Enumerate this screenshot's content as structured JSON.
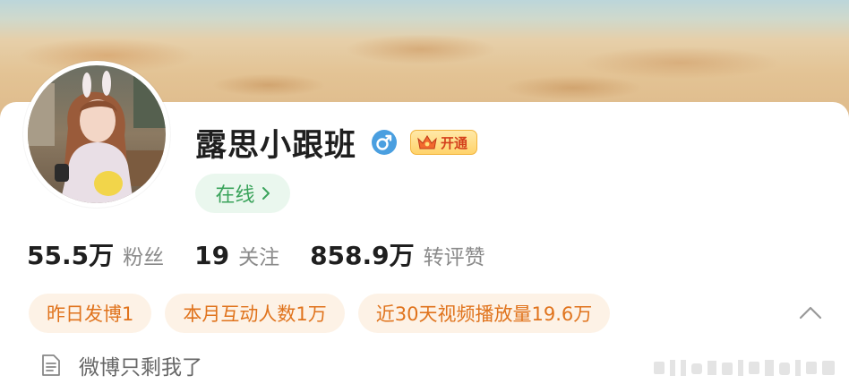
{
  "profile": {
    "name": "露思小跟班",
    "gender_icon": "male-icon",
    "vip_label": "开通",
    "online_label": "在线"
  },
  "stats": [
    {
      "value": "55.5万",
      "label": "粉丝"
    },
    {
      "value": "19",
      "label": "关注"
    },
    {
      "value": "858.9万",
      "label": "转评赞"
    }
  ],
  "tags": [
    {
      "text": "昨日发博1"
    },
    {
      "text": "本月互动人数1万"
    },
    {
      "text": "近30天视频播放量19.6万"
    }
  ],
  "bio": {
    "icon": "document-icon",
    "text": "微博只剩我了"
  },
  "colors": {
    "online_green": "#3aa35b",
    "online_bg": "#eaf7ee",
    "tag_orange": "#e0731c",
    "tag_bg": "#fdf2e6",
    "male_blue": "#4a9fe0",
    "vip_red": "#d4401c"
  }
}
